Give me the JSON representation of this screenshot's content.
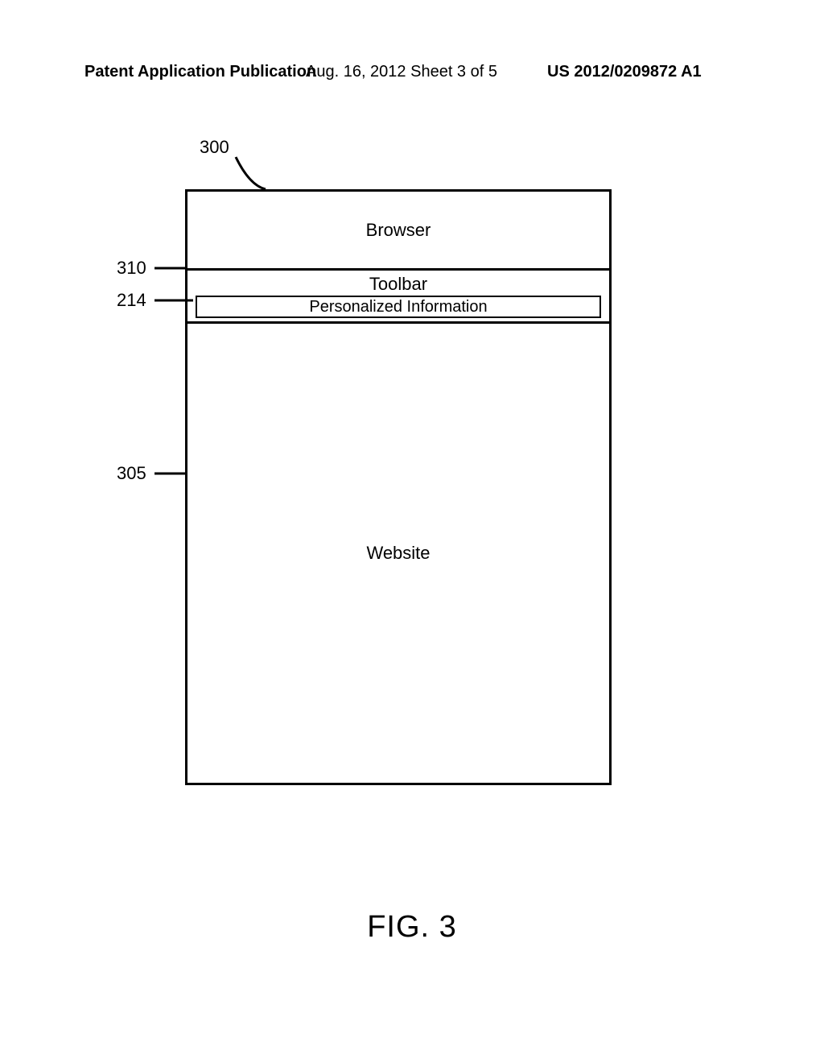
{
  "header": {
    "publication_type": "Patent Application Publication",
    "date_sheet": "Aug. 16, 2012   Sheet 3 of 5",
    "pub_number": "US 2012/0209872 A1"
  },
  "figure_label": "FIG. 3",
  "refs": {
    "r300": "300",
    "r310": "310",
    "r214": "214",
    "r305": "305"
  },
  "boxes": {
    "browser": "Browser",
    "toolbar": "Toolbar",
    "personalized": "Personalized Information",
    "website": "Website"
  }
}
